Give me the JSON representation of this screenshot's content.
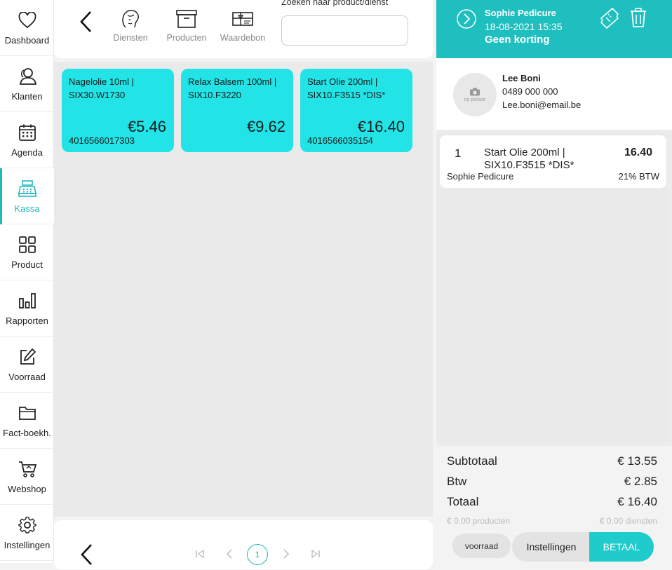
{
  "sidebar": {
    "items": [
      {
        "label": "Dashboard",
        "icon": "heart-icon"
      },
      {
        "label": "Klanten",
        "icon": "users-icon"
      },
      {
        "label": "Agenda",
        "icon": "calendar-icon"
      },
      {
        "label": "Kassa",
        "icon": "cash-register-icon",
        "active": true
      },
      {
        "label": "Product",
        "icon": "grid-icon"
      },
      {
        "label": "Rapporten",
        "icon": "bar-chart-icon"
      },
      {
        "label": "Voorraad",
        "icon": "edit-icon"
      },
      {
        "label": "Fact-boekh.",
        "icon": "folder-icon"
      },
      {
        "label": "Webshop",
        "icon": "cart-icon"
      },
      {
        "label": "Instellingen",
        "icon": "gear-icon"
      }
    ],
    "accent": "#1fb8bf"
  },
  "toolbar": {
    "tools": [
      {
        "label": "Diensten",
        "icon": "face-icon"
      },
      {
        "label": "Producten",
        "icon": "box-icon"
      },
      {
        "label": "Waardebon",
        "icon": "gift-voucher-icon"
      }
    ],
    "search_label": "Zoeken naar product/dienst",
    "search_value": ""
  },
  "products": [
    {
      "name": "Nagelolie 10ml | SIX30.W1730",
      "price": "€5.46",
      "code": "4016566017303"
    },
    {
      "name": "Relax Balsem 100ml | SIX10.F3220",
      "price": "€9.62",
      "code": ""
    },
    {
      "name": "Start Olie 200ml | SIX10.F3515 *DIS*",
      "price": "€16.40",
      "code": "4016566035154"
    }
  ],
  "pager": {
    "current_page": "1"
  },
  "order": {
    "employee": "Sophie Pedicure",
    "datetime": "18-08-2021 15:35",
    "discount": "Geen korting",
    "header_color": "#1fbfbf"
  },
  "customer": {
    "name": "Lee Boni",
    "phone": "0489 000 000",
    "email": "Lee.boni@email.be",
    "avatar_text": "no picture"
  },
  "cart": {
    "lines": [
      {
        "qty": "1",
        "description": "Start Olie 200ml | SIX10.F3515 *DIS*",
        "amount": "16.40",
        "employee": "Sophie Pedicure",
        "vat": "21% BTW"
      }
    ]
  },
  "totals": {
    "subtotal_label": "Subtotaal",
    "subtotal": "€ 13.55",
    "vat_label": "Btw",
    "vat": "€ 2.85",
    "total_label": "Totaal",
    "total": "€ 16.40",
    "products_total": "€ 0.00 producten",
    "services_total": "€ 0.00 diensten"
  },
  "actions": {
    "stock_label": "voorraad",
    "settings_label": "Instellingen",
    "pay_label": "BETAAL"
  }
}
